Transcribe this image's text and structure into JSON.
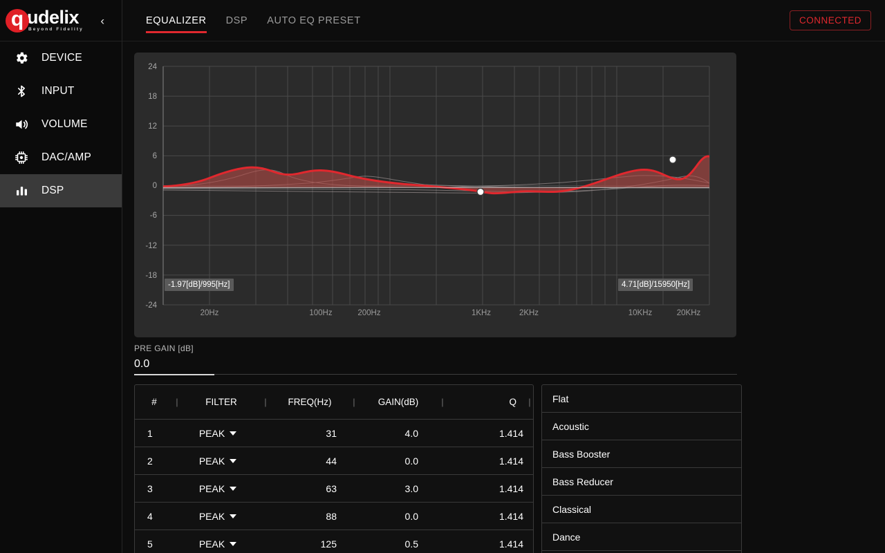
{
  "brand": {
    "logo_letter": "q",
    "logo_name": "udelix",
    "tagline": "Beyond Fidelity",
    "collapse_icon": "‹"
  },
  "sidebar": {
    "items": [
      {
        "label": "DEVICE",
        "icon": "gear-icon",
        "active": false
      },
      {
        "label": "INPUT",
        "icon": "bluetooth-icon",
        "active": false
      },
      {
        "label": "VOLUME",
        "icon": "speaker-icon",
        "active": false
      },
      {
        "label": "DAC/AMP",
        "icon": "chip-icon",
        "active": false
      },
      {
        "label": "DSP",
        "icon": "bars-icon",
        "active": true
      }
    ]
  },
  "header": {
    "tabs": [
      {
        "label": "EQUALIZER",
        "active": true
      },
      {
        "label": "DSP",
        "active": false
      },
      {
        "label": "AUTO EQ PRESET",
        "active": false
      }
    ],
    "connection_status": "CONNECTED",
    "accent_color": "#e0282e"
  },
  "chart_data": {
    "type": "line",
    "title": "",
    "xlabel": "",
    "ylabel": "",
    "ylim": [
      -24,
      24
    ],
    "yticks": [
      24,
      18,
      12,
      6,
      0,
      -6,
      -12,
      -18,
      -24
    ],
    "xticks": [
      "20Hz",
      "100Hz",
      "200Hz",
      "1KHz",
      "2KHz",
      "10KHz",
      "20KHz"
    ],
    "xlim_hz": [
      10,
      24000
    ],
    "grid": true,
    "legend": "none",
    "curve_color": "#e0282e",
    "fill_color": "rgba(224,40,46,0.35)",
    "series": [
      {
        "name": "composite-response",
        "points_hz_db": [
          [
            10,
            0.3
          ],
          [
            20,
            0.6
          ],
          [
            31,
            2.2
          ],
          [
            44,
            3.4
          ],
          [
            55,
            3.1
          ],
          [
            63,
            2.9
          ],
          [
            80,
            2.4
          ],
          [
            88,
            2.3
          ],
          [
            110,
            2.6
          ],
          [
            125,
            2.7
          ],
          [
            160,
            2.2
          ],
          [
            250,
            1.5
          ],
          [
            400,
            0.9
          ],
          [
            630,
            0.3
          ],
          [
            800,
            -0.8
          ],
          [
            995,
            -1.97
          ],
          [
            1400,
            -1.4
          ],
          [
            2000,
            -1.2
          ],
          [
            2800,
            -1.6
          ],
          [
            4000,
            -0.4
          ],
          [
            5600,
            1.0
          ],
          [
            7000,
            2.6
          ],
          [
            8000,
            3.0
          ],
          [
            9000,
            2.6
          ],
          [
            11000,
            1.9
          ],
          [
            13000,
            2.4
          ],
          [
            15950,
            4.71
          ],
          [
            18000,
            1.2
          ],
          [
            20000,
            0.4
          ],
          [
            24000,
            0.2
          ]
        ]
      }
    ],
    "handles": [
      {
        "label": "-1.97[dB]/995[Hz]",
        "gain_db": -1.97,
        "freq_hz": 995
      },
      {
        "label": "4.71[dB]/15950[Hz]",
        "gain_db": 4.71,
        "freq_hz": 15950
      }
    ]
  },
  "pre_gain": {
    "label": "PRE GAIN [dB]",
    "value": "0.0"
  },
  "eq_table": {
    "headers": {
      "num": "#",
      "filter": "FILTER",
      "freq": "FREQ(Hz)",
      "gain": "GAIN(dB)",
      "q": "Q",
      "divider": "|"
    },
    "rows": [
      {
        "num": "1",
        "filter": "PEAK",
        "freq": "31",
        "gain": "4.0",
        "q": "1.414"
      },
      {
        "num": "2",
        "filter": "PEAK",
        "freq": "44",
        "gain": "0.0",
        "q": "1.414"
      },
      {
        "num": "3",
        "filter": "PEAK",
        "freq": "63",
        "gain": "3.0",
        "q": "1.414"
      },
      {
        "num": "4",
        "filter": "PEAK",
        "freq": "88",
        "gain": "0.0",
        "q": "1.414"
      },
      {
        "num": "5",
        "filter": "PEAK",
        "freq": "125",
        "gain": "0.5",
        "q": "1.414"
      }
    ]
  },
  "presets": {
    "items": [
      {
        "label": "Flat"
      },
      {
        "label": "Acoustic"
      },
      {
        "label": "Bass Booster"
      },
      {
        "label": "Bass Reducer"
      },
      {
        "label": "Classical"
      },
      {
        "label": "Dance"
      }
    ]
  }
}
